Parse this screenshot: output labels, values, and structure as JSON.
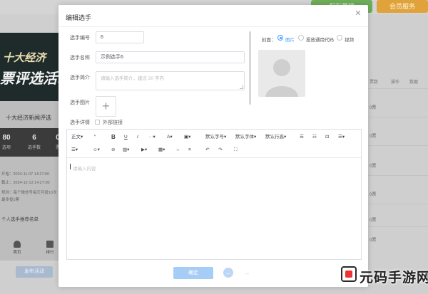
{
  "background": {
    "top_buttons": [
      "保存草稿",
      "会员服务"
    ],
    "banner_line1": "十大经济",
    "banner_line2": "票评选活动",
    "event_title": "十大经济新闻评选",
    "stats": [
      {
        "value": "80",
        "label": "选项"
      },
      {
        "value": "6",
        "label": "选手数"
      },
      {
        "value": "0",
        "label": "票"
      }
    ],
    "meta": [
      "开始：2024-11-07 14:27:00",
      "截止：2024-12-13 14:27:00",
      "规则：每个微信号每天可投10次，每次",
      "      最多投1票"
    ],
    "link_text": "个人选手推荐名单",
    "bottom_nav": [
      "首页",
      "排行"
    ],
    "publish_button": "发布活动",
    "right_columns": [
      "票数",
      "操作",
      "数据"
    ],
    "right_values": [
      "0票",
      "0票",
      "0票",
      "0票",
      "0票",
      "0票"
    ]
  },
  "modal": {
    "title": "编辑选手",
    "close_icon": "close-icon",
    "fields": {
      "number_label": "选手编号",
      "number_value": "6",
      "name_label": "选手名称",
      "name_value": "示例选手6",
      "intro_label": "选手简介",
      "intro_placeholder": "请输入选手简介，建议 20 字内",
      "image_label": "选手图片",
      "detail_label": "选手详情",
      "external_link_label": "外部链接"
    },
    "media": {
      "label": "封面：",
      "options": [
        "图片",
        "投放通用代码",
        "视频"
      ],
      "selected": "图片"
    },
    "toolbar": {
      "row1": [
        "正文",
        "“",
        "B",
        "U",
        "I",
        "···",
        "A",
        "▣",
        "默认字号",
        "默认字体",
        "默认行高",
        "☰",
        "☷",
        "⊡",
        "☰"
      ],
      "row2": [
        "☰",
        "☺",
        "⊘",
        "▨",
        "▶",
        "▦",
        "↔",
        "≡",
        "↶",
        "↷",
        "⛶"
      ]
    },
    "editor_placeholder": "请输入内容",
    "confirm_button": "确定"
  },
  "watermark": {
    "text": "元码手游网"
  }
}
